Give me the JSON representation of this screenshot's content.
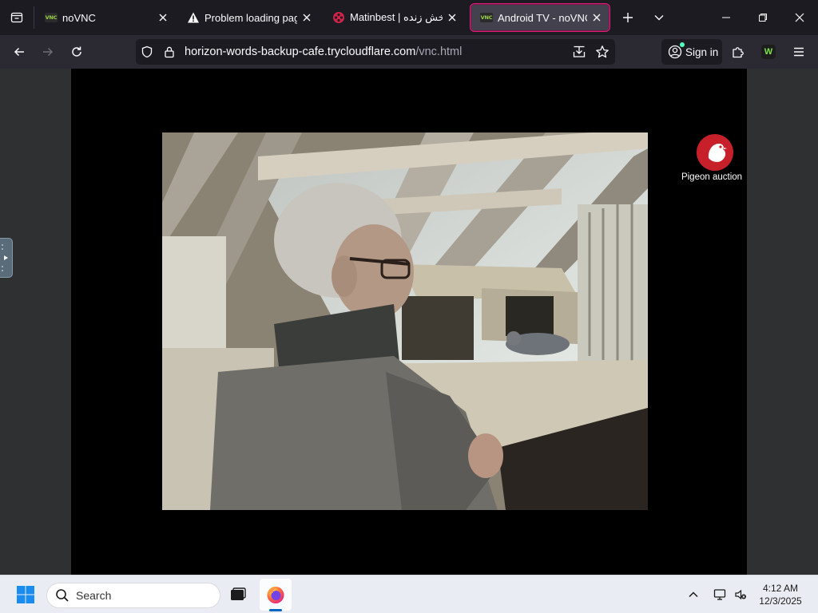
{
  "browser": {
    "tabs": [
      {
        "title": "noVNC",
        "favicon": "vnc-icon",
        "active": false
      },
      {
        "title": "Problem loading page",
        "favicon": "warning-icon",
        "active": false
      },
      {
        "title": "Matinbest | پخش زنده",
        "favicon": "film-reel-icon",
        "active": false
      },
      {
        "title": "Android TV - noVNC",
        "favicon": "vnc-icon",
        "active": true
      }
    ],
    "new_tab_icon": "plus-icon",
    "tab_list_icon": "chevron-down-icon",
    "url": {
      "host": "horizon-words-backup-cafe.trycloudflare.com",
      "path": "/vnc.html"
    },
    "signin_label": "Sign in",
    "accent_color": "#e01b7a"
  },
  "vnc": {
    "overlay_logo_text": "Pigeon auction",
    "logo_color": "#c8202a"
  },
  "taskbar": {
    "search_placeholder": "Search",
    "time": "4:12 AM",
    "date": "12/3/2025"
  }
}
